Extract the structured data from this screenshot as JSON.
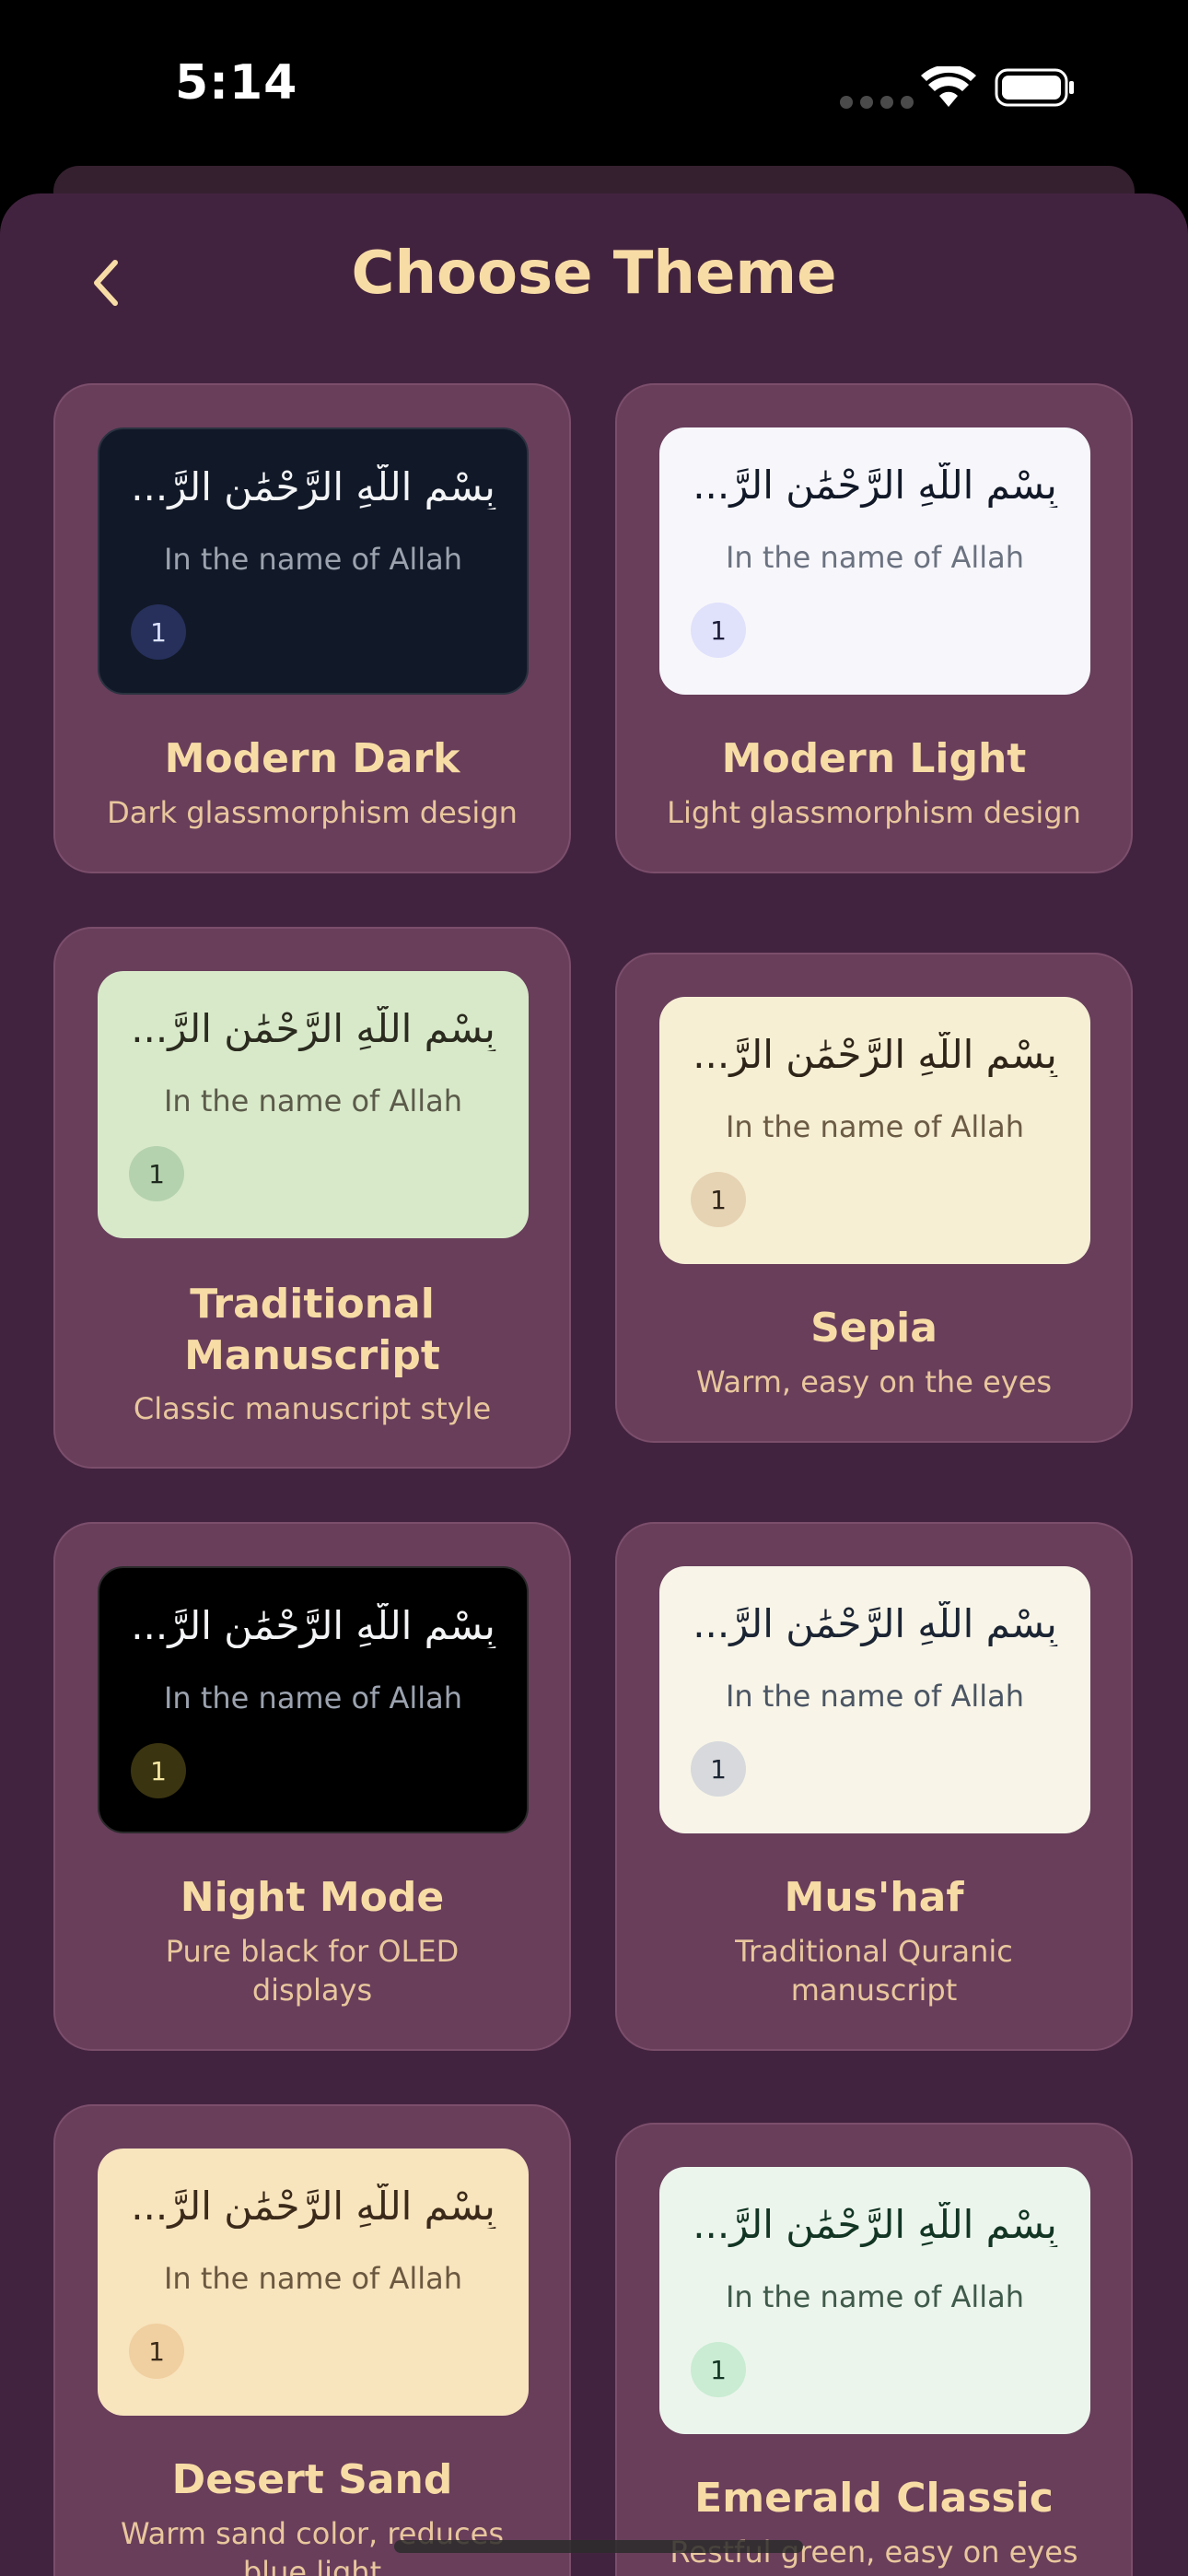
{
  "status_bar": {
    "time": "5:14"
  },
  "header": {
    "title": "Choose Theme",
    "back_icon": "chevron-left-icon"
  },
  "colors": {
    "accent": "#f8dca6",
    "sheet_bg": "#42233f",
    "card_bg": "#683e5b"
  },
  "themes": [
    {
      "name": "Modern Dark",
      "description": "Dark glassmorphism design",
      "arabic": "بِسْمِ اللَّهِ الرَّحْمَٰنِ الرَّ...",
      "translation": "In the name of Allah",
      "verse_number": "1",
      "preview_bg": "#111827",
      "arabic_color": "#f3f4f6",
      "translation_color": "#9ca3af",
      "badge_bg": "#26305a",
      "badge_color": "#dbe1ff"
    },
    {
      "name": "Modern Light",
      "description": "Light glassmorphism design",
      "arabic": "بِسْمِ اللَّهِ الرَّحْمَٰنِ الرَّ...",
      "translation": "In the name of Allah",
      "verse_number": "1",
      "preview_bg": "#f7f7fb",
      "arabic_color": "#111827",
      "translation_color": "#6b7280",
      "badge_bg": "#e0e1fb",
      "badge_color": "#1e1e3a"
    },
    {
      "name": "Traditional Manuscript",
      "description": "Classic manuscript style",
      "arabic": "بِسْمِ اللَّهِ الرَّحْمَٰنِ الرَّ...",
      "translation": "In the name of Allah",
      "verse_number": "1",
      "preview_bg": "#d8e9c9",
      "arabic_color": "#2b2b1f",
      "translation_color": "#5b5b4a",
      "badge_bg": "#b4d2ad",
      "badge_color": "#1f2a1f"
    },
    {
      "name": "Sepia",
      "description": "Warm, easy on the eyes",
      "arabic": "بِسْمِ اللَّهِ الرَّحْمَٰنِ الرَّ...",
      "translation": "In the name of Allah",
      "verse_number": "1",
      "preview_bg": "#f6efd4",
      "arabic_color": "#2f2418",
      "translation_color": "#6b5b45",
      "badge_bg": "#e6d3b3",
      "badge_color": "#2f2418"
    },
    {
      "name": "Night Mode",
      "description": "Pure black for OLED displays",
      "arabic": "بِسْمِ اللَّهِ الرَّحْمَٰنِ الرَّ...",
      "translation": "In the name of Allah",
      "verse_number": "1",
      "preview_bg": "#000000",
      "arabic_color": "#f3f4f6",
      "translation_color": "#9ca3af",
      "badge_bg": "#3a3410",
      "badge_color": "#f5e7a3"
    },
    {
      "name": "Mus'haf",
      "description": "Traditional Quranic manuscript",
      "arabic": "بِسْمِ اللَّهِ الرَّحْمَٰنِ الرَّ...",
      "translation": "In the name of Allah",
      "verse_number": "1",
      "preview_bg": "#f8f5e8",
      "arabic_color": "#1b2433",
      "translation_color": "#4b5563",
      "badge_bg": "#d7d9dc",
      "badge_color": "#1b2433"
    },
    {
      "name": "Desert Sand",
      "description": "Warm sand color, reduces blue light",
      "arabic": "بِسْمِ اللَّهِ الرَّحْمَٰنِ الرَّ...",
      "translation": "In the name of Allah",
      "verse_number": "1",
      "preview_bg": "#f8e4bd",
      "arabic_color": "#3b2a1a",
      "translation_color": "#6b5840",
      "badge_bg": "#f0cfa0",
      "badge_color": "#3b2a1a"
    },
    {
      "name": "Emerald Classic",
      "description": "Restful green, easy on eyes",
      "arabic": "بِسْمِ اللَّهِ الرَّحْمَٰنِ الرَّ...",
      "translation": "In the name of Allah",
      "verse_number": "1",
      "preview_bg": "#ecf5ec",
      "arabic_color": "#123524",
      "translation_color": "#3f5a4a",
      "badge_bg": "#c9ecd3",
      "badge_color": "#123524"
    }
  ]
}
